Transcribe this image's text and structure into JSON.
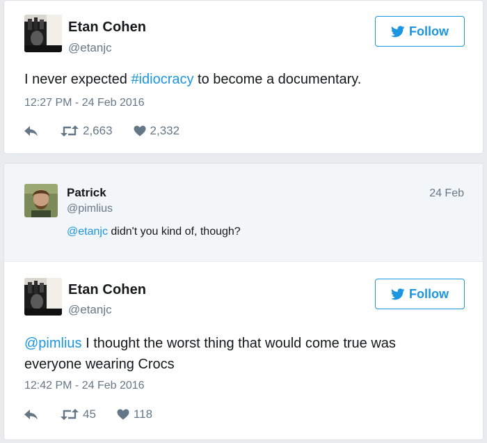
{
  "tweet1": {
    "name": "Etan Cohen",
    "handle": "@etanjc",
    "follow_label": "Follow",
    "text_hashtag": "#idiocracy",
    "text_before": "I never expected ",
    "text_after": " to become a documentary.",
    "timestamp": "12:27 PM - 24 Feb 2016",
    "retweets": "2,663",
    "likes": "2,332"
  },
  "reply": {
    "name": "Patrick",
    "handle": "@pimlius",
    "date": "24 Feb",
    "mention": "@etanjc",
    "text": " didn't you kind of, though?"
  },
  "tweet2": {
    "name": "Etan Cohen",
    "handle": "@etanjc",
    "follow_label": "Follow",
    "mention": "@pimlius",
    "line1": " I thought the worst thing that would come true was",
    "line2": "everyone wearing Crocs",
    "timestamp": "12:42 PM - 24 Feb 2016",
    "retweets": "45",
    "likes": "118"
  },
  "icons": {
    "follow": "twitter-bird-icon",
    "reply": "reply-arrow-icon",
    "retweet": "retweet-icon",
    "like": "heart-icon"
  },
  "colors": {
    "accent": "#1b95e0",
    "muted": "#657786",
    "reply_bg": "#f3f6f8"
  }
}
